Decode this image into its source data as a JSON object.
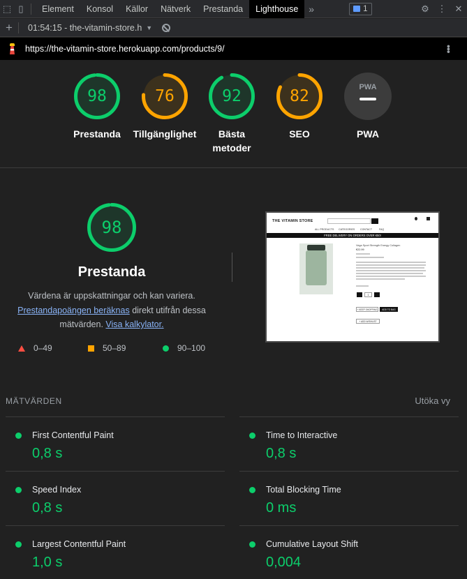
{
  "devtools": {
    "tabs": [
      "Element",
      "Konsol",
      "Källor",
      "Nätverk",
      "Prestanda",
      "Lighthouse"
    ],
    "active_tab": "Lighthouse",
    "more": "»",
    "issues_count": "1"
  },
  "report_bar": {
    "plus": "+",
    "report_label": "01:54:15 - the-vitamin-store.h",
    "caret": "▼"
  },
  "url_bar": {
    "url": "https://the-vitamin-store.herokuapp.com/products/9/",
    "menu": "⋮"
  },
  "categories": [
    {
      "score": "98",
      "label": "Prestanda",
      "value": 98,
      "status": "pass"
    },
    {
      "score": "76",
      "label": "Tillgänglighet",
      "value": 76,
      "status": "average"
    },
    {
      "score": "92",
      "label": "Bästa metoder",
      "value": 92,
      "status": "pass"
    },
    {
      "score": "82",
      "label": "SEO",
      "value": 82,
      "status": "average"
    },
    {
      "score": "",
      "label": "PWA",
      "badge": "PWA"
    }
  ],
  "colors": {
    "pass": "#0cce6b",
    "average": "#ffa400",
    "fail": "#ff4e42",
    "link": "#8ab4f8"
  },
  "performance": {
    "score": "98",
    "value": 98,
    "title": "Prestanda",
    "desc_1": "Värdena är uppskattningar och kan variera.",
    "desc_link_1": "Prestandapoängen beräknas",
    "desc_2": " direkt utifrån dessa mätvärden. ",
    "desc_link_2": "Visa kalkylator.",
    "legend": [
      {
        "range": "0–49",
        "shape": "triangle"
      },
      {
        "range": "50–89",
        "shape": "square"
      },
      {
        "range": "90–100",
        "shape": "circle"
      }
    ]
  },
  "thumbnail": {
    "logo": "THE VITAMIN STORE",
    "nav": [
      "ALL PRODUCTS",
      "CATEGORIES",
      "CONTACT",
      "FAQ"
    ],
    "banner": "FREE DELIVERY ON ORDERS OVER €50!",
    "product_title": "Vega Sport Strength Energy Collagen",
    "price": "€22.99",
    "qty_value": "1",
    "add_btn": "+ KEEP SHOPPING",
    "bag_btn": "ADD TO BAG",
    "wishlist_btn": "+ ADD WISHLIST"
  },
  "metrics": {
    "heading": "MÄTVÄRDEN",
    "expand": "Utöka vy",
    "items": [
      {
        "name": "First Contentful Paint",
        "value": "0,8 s"
      },
      {
        "name": "Time to Interactive",
        "value": "0,8 s"
      },
      {
        "name": "Speed Index",
        "value": "0,8 s"
      },
      {
        "name": "Total Blocking Time",
        "value": "0 ms"
      },
      {
        "name": "Largest Contentful Paint",
        "value": "1,0 s"
      },
      {
        "name": "Cumulative Layout Shift",
        "value": "0,004"
      }
    ]
  }
}
